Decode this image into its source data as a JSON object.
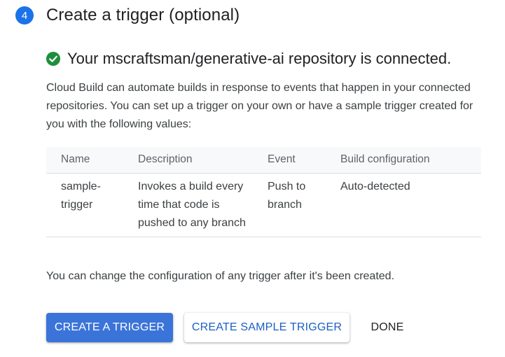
{
  "step": {
    "number": "4",
    "title": "Create a trigger (optional)"
  },
  "status": {
    "icon": "check-circle-icon",
    "color": "#1e8e3e",
    "text": "Your mscraftsman/generative-ai repository is connected."
  },
  "intro": "Cloud Build can automate builds in response to events that happen in your connected repositories. You can set up a trigger on your own or have a sample trigger created for you with the following values:",
  "table": {
    "headers": [
      "Name",
      "Description",
      "Event",
      "Build configuration"
    ],
    "rows": [
      [
        "sample-trigger",
        "Invokes a build every time that code is pushed to any branch",
        "Push to branch",
        "Auto-detected"
      ]
    ]
  },
  "note": "You can change the configuration of any trigger after it's been created.",
  "buttons": {
    "create_trigger": "CREATE A TRIGGER",
    "create_sample": "CREATE SAMPLE TRIGGER",
    "done": "DONE"
  },
  "colors": {
    "accent": "#1a73e8",
    "primary_button": "#3b74d9"
  }
}
